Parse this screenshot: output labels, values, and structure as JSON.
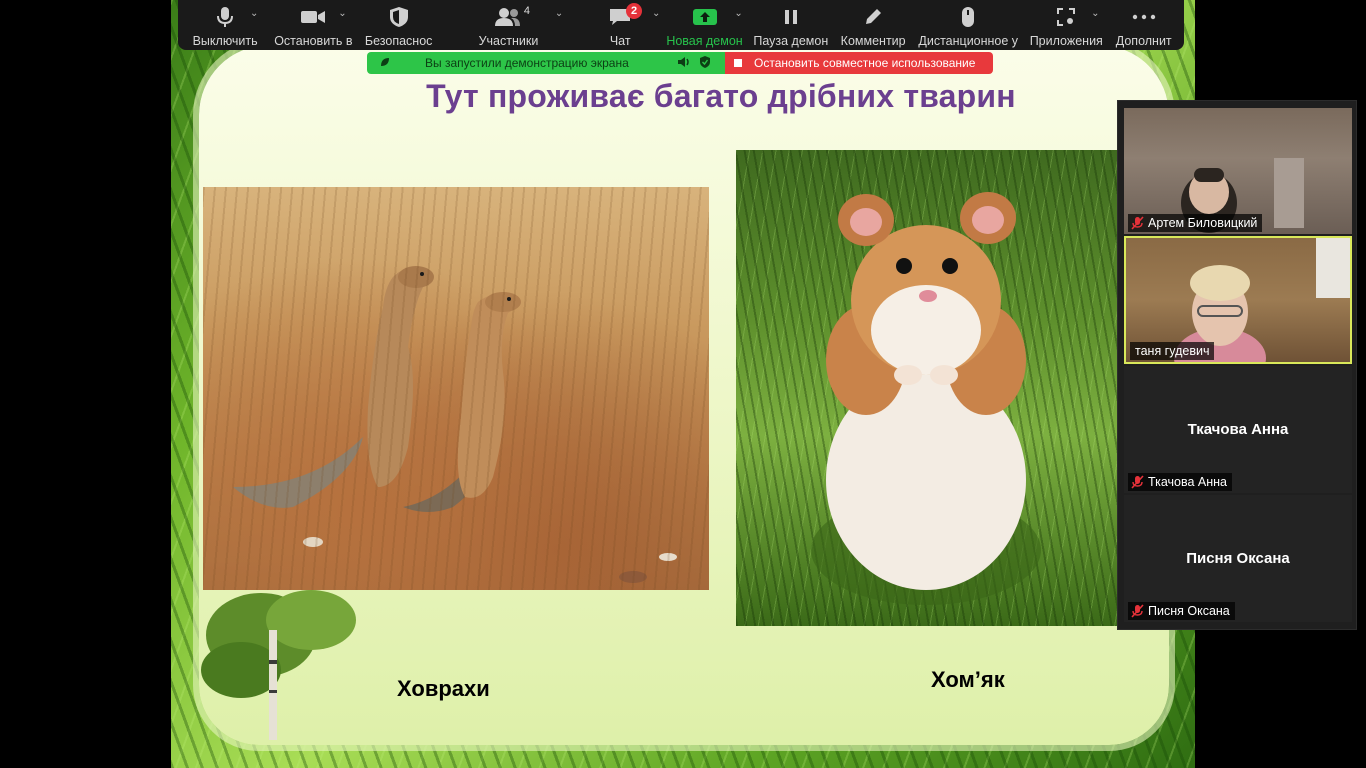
{
  "toolbar": {
    "mute": {
      "label": "Выключить",
      "icon": "microphone-icon"
    },
    "video": {
      "label": "Остановить в",
      "icon": "video-camera-icon"
    },
    "security": {
      "label": "Безопаснос",
      "icon": "shield-icon"
    },
    "participants": {
      "label": "Участники",
      "count": "4",
      "icon": "participants-icon"
    },
    "chat": {
      "label": "Чат",
      "badge": "2",
      "icon": "chat-icon"
    },
    "share": {
      "label": "Новая демон",
      "icon": "share-screen-icon"
    },
    "pause": {
      "label": "Пауза демон",
      "icon": "pause-icon"
    },
    "annotate": {
      "label": "Комментир",
      "icon": "pen-icon"
    },
    "remote": {
      "label": "Дистанционное у",
      "icon": "mouse-icon"
    },
    "apps": {
      "label": "Приложения",
      "icon": "apps-icon"
    },
    "more": {
      "label": "Дополнит",
      "icon": "more-dots-icon"
    }
  },
  "share_bar": {
    "status": "Вы запустили демонстрацию экрана",
    "stop": "Остановить совместное использование"
  },
  "slide": {
    "title": "Тут проживає багато дрібних тварин",
    "caption_left": "Ховрахи",
    "caption_right": "Хом’як"
  },
  "participants": [
    {
      "name": "Артем Биловицкий",
      "video": true
    },
    {
      "name": "таня гудевич",
      "video": true,
      "active_speaker": true
    },
    {
      "name": "Ткачова Анна",
      "video": false
    },
    {
      "name": "Писня Оксана",
      "video": false
    }
  ],
  "colors": {
    "title_purple": "#6b3f8f",
    "share_green": "#2dc548",
    "stop_red": "#e8393c",
    "active_speaker_border": "#d9e85a"
  }
}
